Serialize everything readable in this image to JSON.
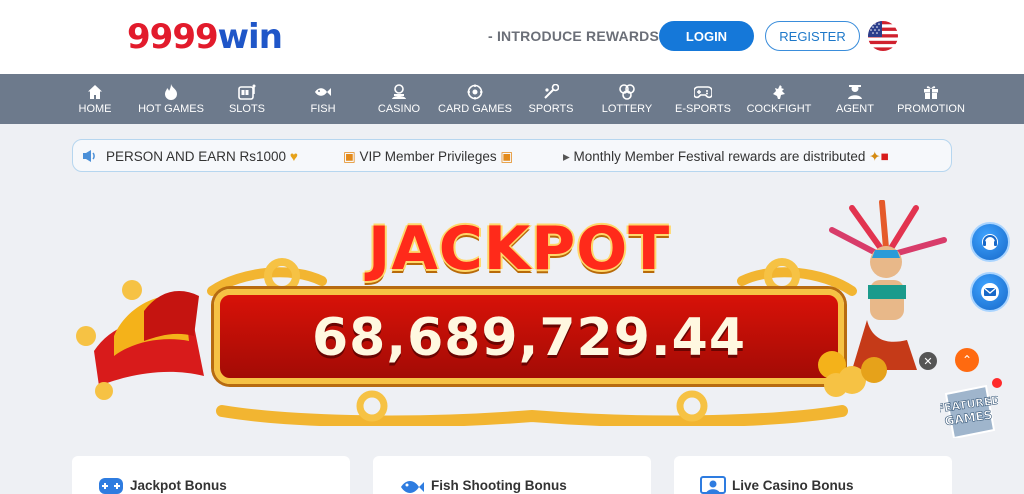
{
  "header": {
    "logo_num": "9999",
    "logo_word": "win",
    "intro_label": "- INTRODUCE REWARDS",
    "login_label": "LOGIN",
    "register_label": "REGISTER",
    "language_flag": "us-flag-icon"
  },
  "nav": {
    "items": [
      {
        "label": "HOME",
        "icon": "home-icon"
      },
      {
        "label": "HOT GAMES",
        "icon": "flame-icon"
      },
      {
        "label": "SLOTS",
        "icon": "slot-machine-icon"
      },
      {
        "label": "FISH",
        "icon": "fish-icon"
      },
      {
        "label": "CASINO",
        "icon": "casino-icon"
      },
      {
        "label": "CARD GAMES",
        "icon": "cards-icon"
      },
      {
        "label": "SPORTS",
        "icon": "sports-icon"
      },
      {
        "label": "LOTTERY",
        "icon": "lottery-icon"
      },
      {
        "label": "E-SPORTS",
        "icon": "gamepad-icon"
      },
      {
        "label": "COCKFIGHT",
        "icon": "rooster-icon"
      },
      {
        "label": "AGENT",
        "icon": "agent-icon"
      },
      {
        "label": "PROMOTION",
        "icon": "gift-icon"
      }
    ]
  },
  "marquee": {
    "items": [
      "PERSON AND EARN Rs1000",
      "VIP Member Privileges",
      "Monthly Member Festival rewards are distributed"
    ]
  },
  "jackpot": {
    "title": "JACKPOT",
    "amount": "68,689,729.44"
  },
  "featured_badge": "FEATURED GAMES",
  "bonus_cards": [
    {
      "title": "Jackpot Bonus",
      "icon": "gamepad-plus-icon"
    },
    {
      "title": "Fish Shooting Bonus",
      "icon": "fish-icon"
    },
    {
      "title": "Live Casino Bonus",
      "icon": "live-casino-icon"
    }
  ],
  "colors": {
    "brand_red": "#e21b2c",
    "brand_blue": "#1f56c8",
    "nav_bg": "#6d7a8c",
    "login_bg": "#1578d9"
  }
}
